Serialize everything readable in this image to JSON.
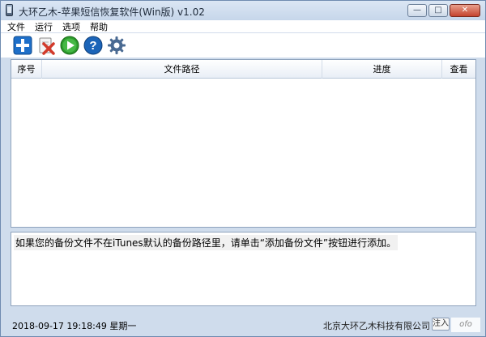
{
  "window": {
    "title": "大环乙木-苹果短信恢复软件(Win版)   v1.02",
    "minimize_icon": "minimize-icon",
    "maximize_icon": "maximize-icon",
    "close_icon": "close-icon"
  },
  "menu": {
    "items": [
      {
        "label": "文件"
      },
      {
        "label": "运行"
      },
      {
        "label": "选项"
      },
      {
        "label": "帮助"
      }
    ]
  },
  "toolbar": {
    "buttons": [
      {
        "icon": "add-icon",
        "color": "#1e6fc9"
      },
      {
        "icon": "delete-icon",
        "color": "#d23a2a"
      },
      {
        "icon": "run-icon",
        "color": "#2c9b2c"
      },
      {
        "icon": "help-icon",
        "color": "#1b64b8"
      },
      {
        "icon": "settings-gear-icon",
        "color": "#4a6a92"
      }
    ]
  },
  "table": {
    "columns": [
      "序号",
      "文件路径",
      "进度",
      "查看"
    ],
    "rows": []
  },
  "message": {
    "text": "如果您的备份文件不在iTunes默认的备份路径里，请单击“添加备份文件”按钮进行添加。"
  },
  "status": {
    "datetime": "2018-09-17  19:18:49  星期一",
    "company": "北京大环乙木科技有限公司",
    "tag": "注入"
  },
  "watermark": "ofo"
}
